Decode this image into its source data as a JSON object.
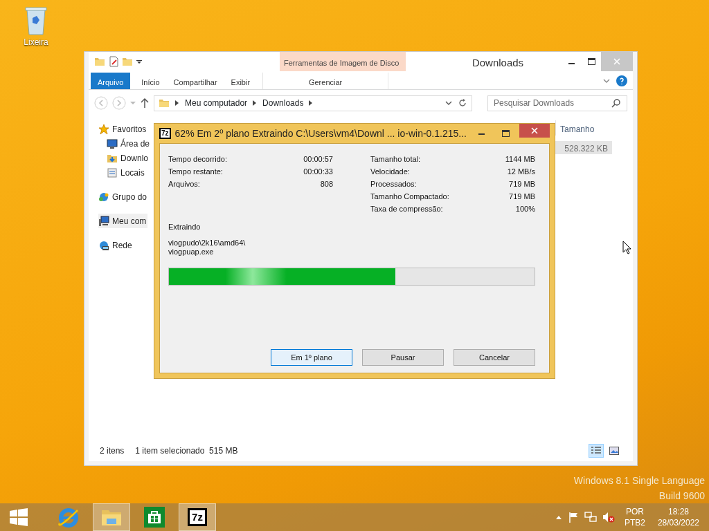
{
  "desktop_icons": [
    {
      "label": "Lixeira"
    }
  ],
  "explorer": {
    "title": "Downloads",
    "context_group": "Ferramentas de Imagem de Disco",
    "ribbon_tabs": [
      {
        "label": "Arquivo",
        "kind": "file",
        "selected": false
      },
      {
        "label": "Início",
        "kind": "tab",
        "selected": false
      },
      {
        "label": "Compartilhar",
        "kind": "tab",
        "selected": false
      },
      {
        "label": "Exibir",
        "kind": "tab",
        "selected": false
      },
      {
        "label": "Gerenciar",
        "kind": "context",
        "selected": false
      }
    ],
    "breadcrumbs": [
      "Meu computador",
      "Downloads"
    ],
    "search": {
      "placeholder": "Pesquisar Downloads"
    },
    "nav": [
      {
        "label": "Favoritos",
        "kind": "star",
        "selected": false,
        "children": [
          {
            "label": "Área de",
            "kind": "desktop",
            "selected": false
          },
          {
            "label": "Downlo",
            "kind": "downloads",
            "selected": false
          },
          {
            "label": "Locais",
            "kind": "places",
            "selected": false
          }
        ]
      },
      {
        "label": "Grupo do",
        "kind": "homegroup",
        "selected": false
      },
      {
        "label": "Meu com",
        "kind": "computer",
        "selected": true
      },
      {
        "label": "Rede",
        "kind": "network",
        "selected": false
      }
    ],
    "columns": [
      "Tamanho"
    ],
    "rows": [
      {
        "size": "528.322 KB",
        "selected": true
      }
    ],
    "status_bar": {
      "count": "2 itens",
      "selection": "1 item selecionado  515 MB"
    },
    "view_buttons": [
      {
        "kind": "details",
        "selected": true
      },
      {
        "kind": "icons",
        "selected": false
      }
    ]
  },
  "dialog": {
    "logo": "7z",
    "title": "62% Em 2º plano Extraindo C:\\Users\\vm4\\Downl ... io-win-0.1.215...",
    "stats_left": [
      {
        "label": "Tempo decorrido:",
        "value": "00:00:57"
      },
      {
        "label": "Tempo restante:",
        "value": "00:00:33"
      },
      {
        "label": "Arquivos:",
        "value": "808"
      }
    ],
    "stats_right": [
      {
        "label": "Tamanho total:",
        "value": "1144 MB"
      },
      {
        "label": "Velocidade:",
        "value": "12 MB/s"
      },
      {
        "label": "Processados:",
        "value": "719 MB"
      },
      {
        "label": "Tamanho Compactado:",
        "value": "719 MB"
      },
      {
        "label": "Taxa de compressão:",
        "value": "100%"
      }
    ],
    "current_label": "Extraindo",
    "current_file": [
      "viogpudo\\2k16\\amd64\\",
      "viogpuap.exe"
    ],
    "progress": {
      "level": 0.62
    },
    "buttons": [
      {
        "label": "Em 1º plano",
        "selected": true
      },
      {
        "label": "Pausar",
        "selected": false
      },
      {
        "label": "Cancelar",
        "selected": false
      }
    ]
  },
  "os_notice": [
    "Windows 8.1 Single Language",
    "Build 9600"
  ],
  "taskbar": {
    "apps": [
      {
        "kind": "start",
        "selected": false
      },
      {
        "kind": "ie",
        "selected": false
      },
      {
        "kind": "explorer",
        "selected": true
      },
      {
        "kind": "store",
        "selected": false
      },
      {
        "kind": "sevenzip",
        "label": "7z",
        "selected": true
      }
    ],
    "language": [
      "POR",
      "PTB2"
    ],
    "time": "18:28",
    "date": "28/03/2022"
  }
}
